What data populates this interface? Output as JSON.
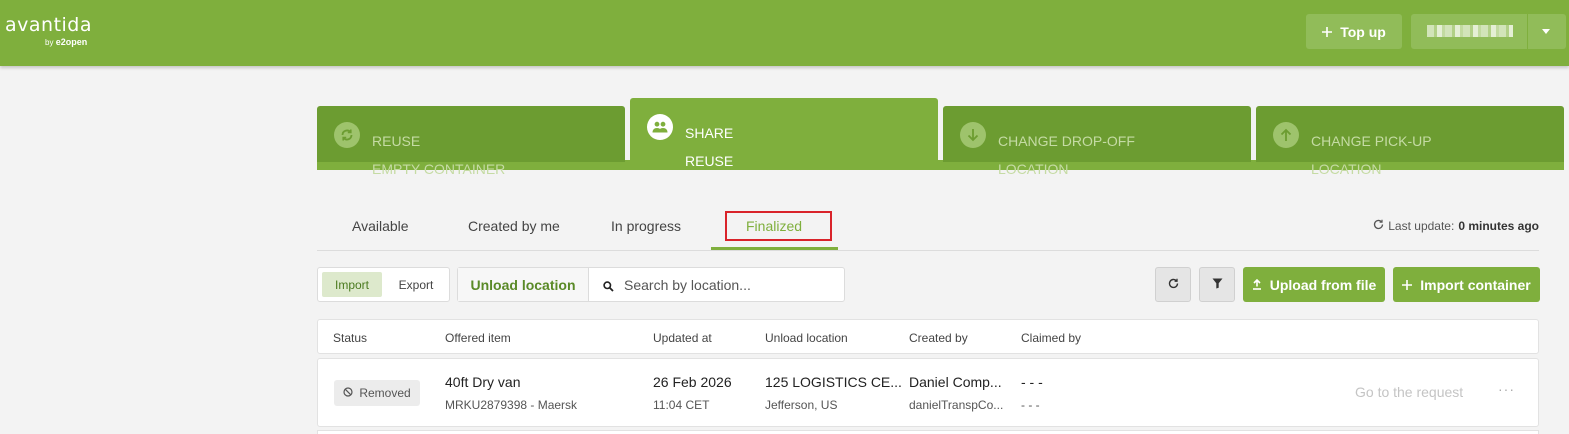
{
  "brand": {
    "name": "avantida",
    "by": "by",
    "parent": "e2open"
  },
  "header": {
    "topup_label": "Top up"
  },
  "services": [
    {
      "line1": "REUSE",
      "line2": "EMPTY CONTAINER",
      "icon": "refresh-icon"
    },
    {
      "line1": "SHARE",
      "line2": "REUSE",
      "icon": "users-icon"
    },
    {
      "line1": "CHANGE DROP-OFF",
      "line2": "LOCATION",
      "icon": "arrow-down-icon"
    },
    {
      "line1": "CHANGE PICK-UP",
      "line2": "LOCATION",
      "icon": "arrow-up-icon"
    }
  ],
  "status_tabs": [
    "Available",
    "Created by me",
    "In progress",
    "Finalized"
  ],
  "active_status_tab": "Finalized",
  "last_update": {
    "label": "Last update:",
    "value": "0 minutes ago"
  },
  "toolbar": {
    "import_label": "Import",
    "export_label": "Export",
    "search_field_label": "Unload location",
    "search_placeholder": "Search by location...",
    "upload_label": "Upload from file",
    "import_container_label": "Import container"
  },
  "table": {
    "columns": [
      "Status",
      "Offered item",
      "Updated at",
      "Unload location",
      "Created by",
      "Claimed by"
    ],
    "rows": [
      {
        "status": "Removed",
        "item_title": "40ft Dry van",
        "item_sub": "MRKU2879398 - Maersk",
        "updated_date": "26 Feb 2026",
        "updated_time": "11:04 CET",
        "location_name": "125 LOGISTICS CE...",
        "location_city": "Jefferson, US",
        "created_name": "Daniel Comp...",
        "created_email": "danielTranspCo...",
        "claimed_name": "- - -",
        "claimed_sub": "- - -",
        "action_label": "Go to the request",
        "more_label": "···"
      }
    ]
  },
  "colors": {
    "brand_green": "#7faf3d",
    "dark_green": "#6c9c31",
    "highlight_red": "#d9232a"
  }
}
